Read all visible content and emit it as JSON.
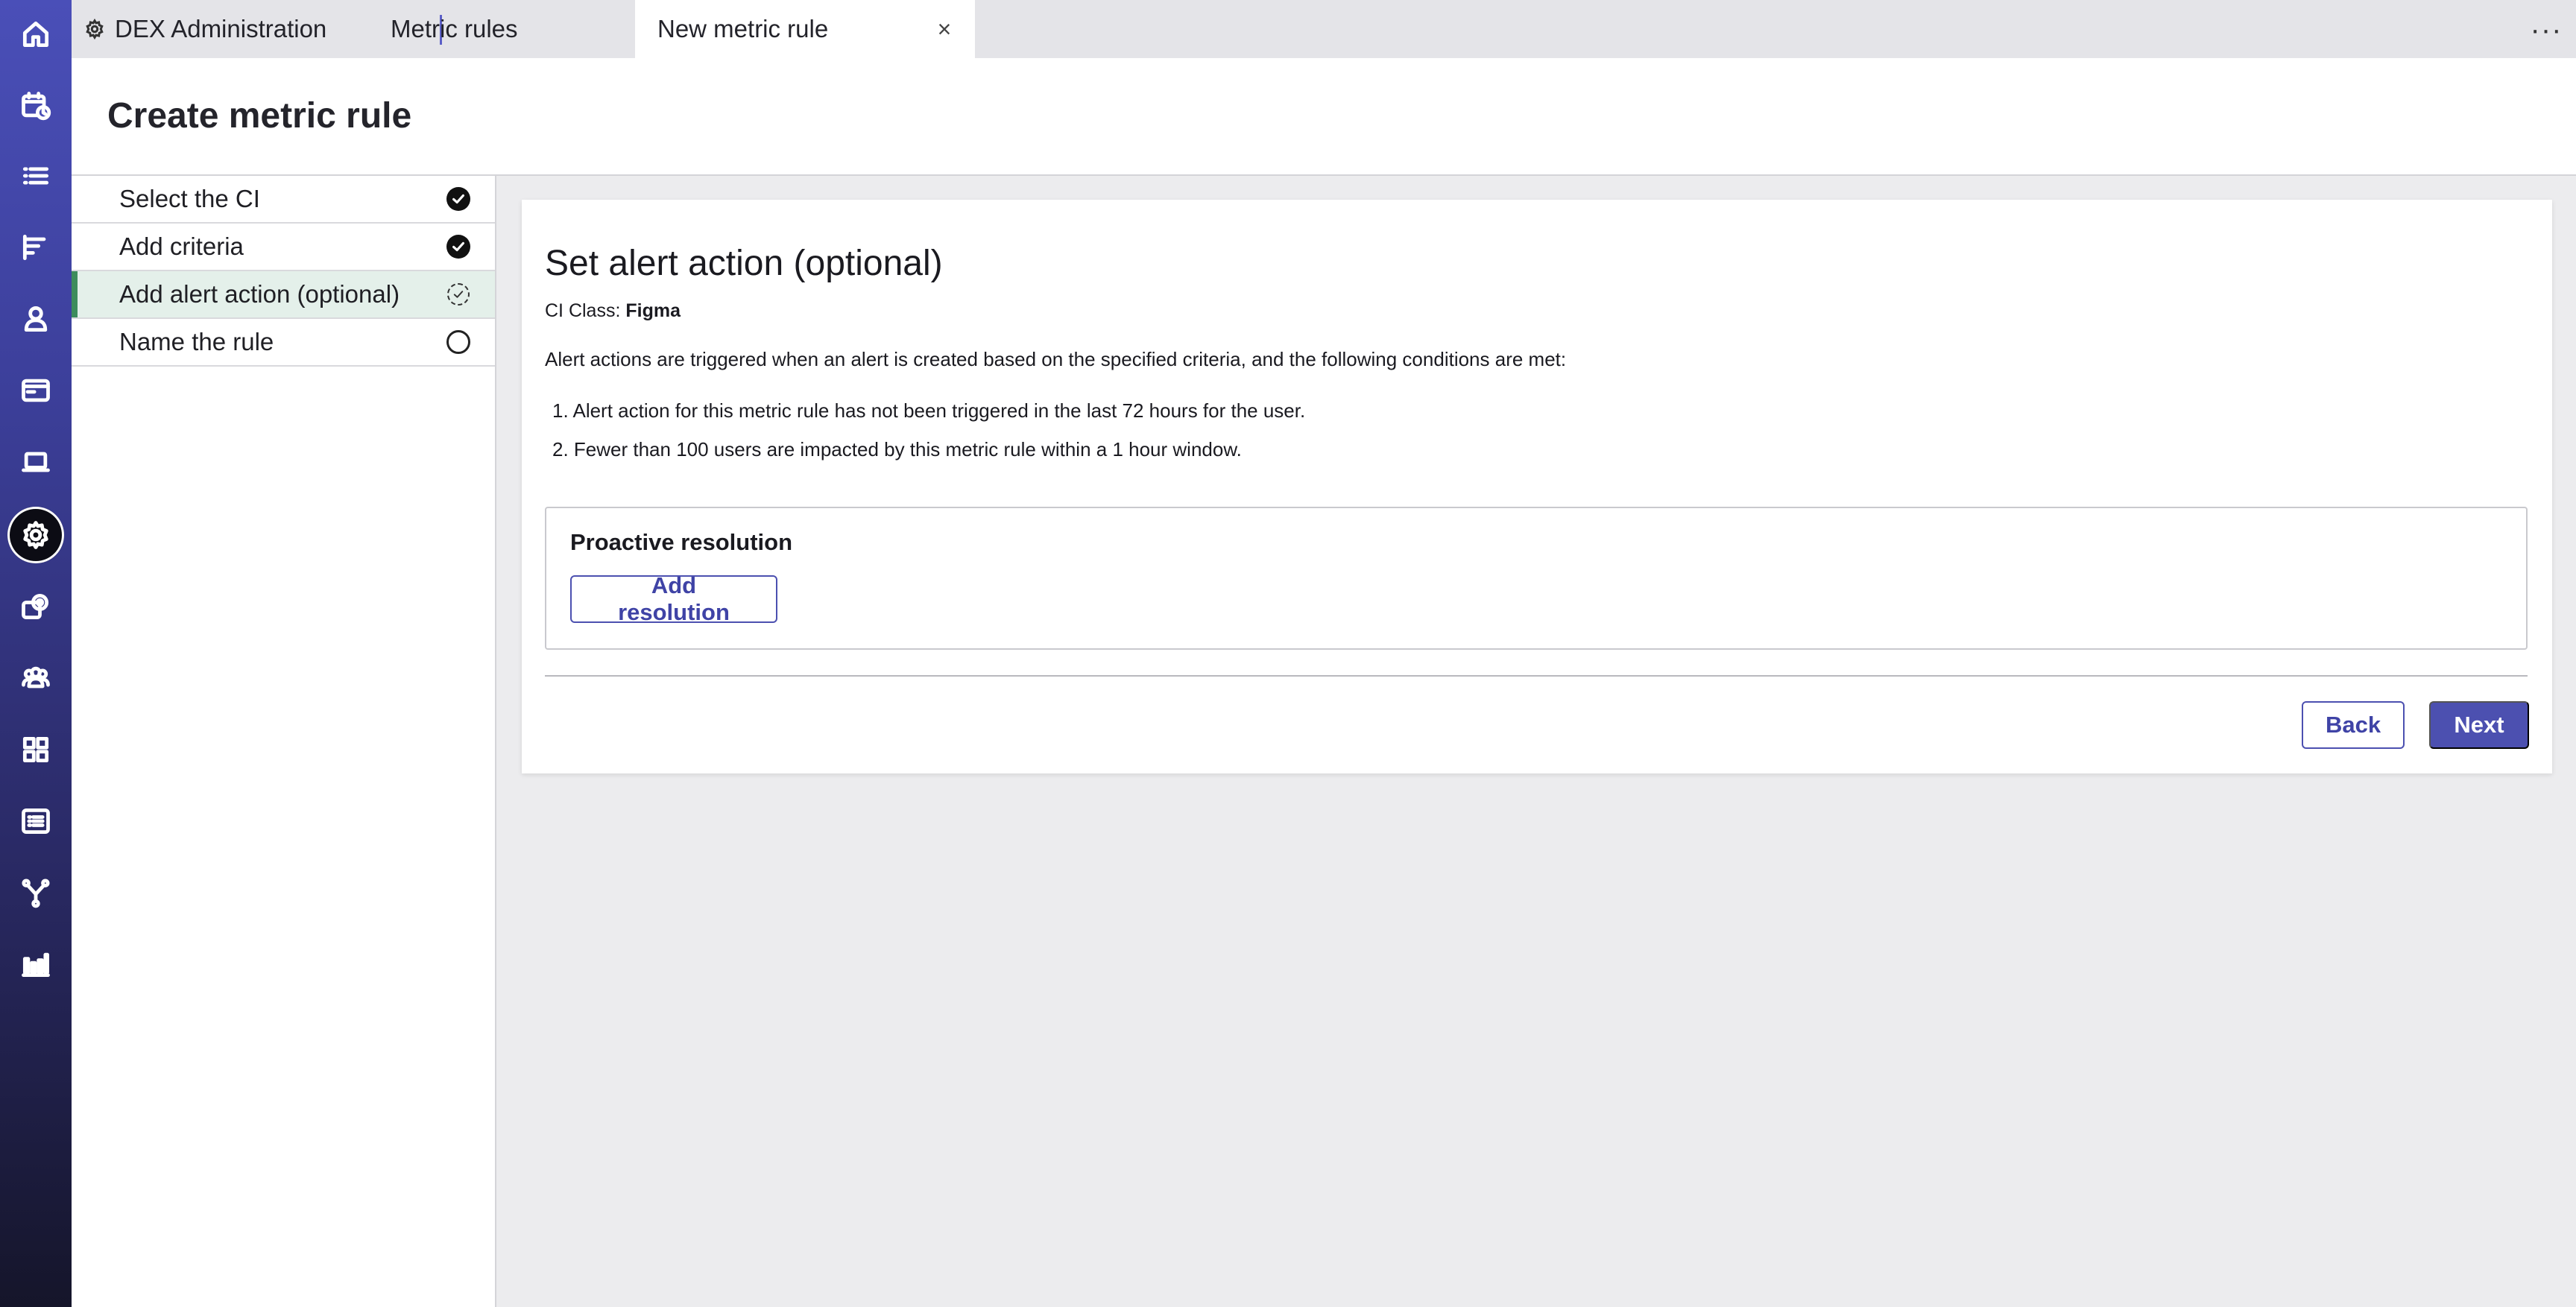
{
  "tabs": [
    {
      "label": "DEX Administration",
      "icon": "gear-icon"
    },
    {
      "label": "Metric rules",
      "close": "×"
    },
    {
      "label": "New metric rule",
      "close": "×"
    }
  ],
  "more_menu": "···",
  "header": {
    "title": "Create metric rule"
  },
  "steps": [
    {
      "label": "Select the CI",
      "status": "done"
    },
    {
      "label": "Add criteria",
      "status": "done"
    },
    {
      "label": "Add alert action (optional)",
      "status": "in-progress"
    },
    {
      "label": "Name the rule",
      "status": "pending"
    }
  ],
  "main": {
    "title": "Set alert action (optional)",
    "ci_class_label": "CI Class: ",
    "ci_class_value": "Figma",
    "description": "Alert actions are triggered when an alert is created based on the specified criteria, and the following conditions are met:",
    "conditions": [
      "1. Alert action for this metric rule has not been triggered in the last 72 hours for the user.",
      "2. Fewer than 100 users are impacted by this metric rule within a 1 hour window."
    ],
    "resolution": {
      "title": "Proactive resolution",
      "add_button": "Add resolution"
    },
    "back_button": "Back",
    "next_button": "Next"
  },
  "sidebar_icons": [
    "home-icon",
    "calendar-clock-icon",
    "list-icon",
    "gantt-icon",
    "person-icon",
    "window-icon",
    "laptop-icon",
    "settings-icon",
    "gear-stack-icon",
    "team-icon",
    "grid-icon",
    "list-box-icon",
    "branch-icon",
    "bar-chart-icon"
  ],
  "colors": {
    "accent": "#4c50b0",
    "current_step_bg": "#e4f0ea",
    "current_step_bar": "#3d8c5c"
  }
}
